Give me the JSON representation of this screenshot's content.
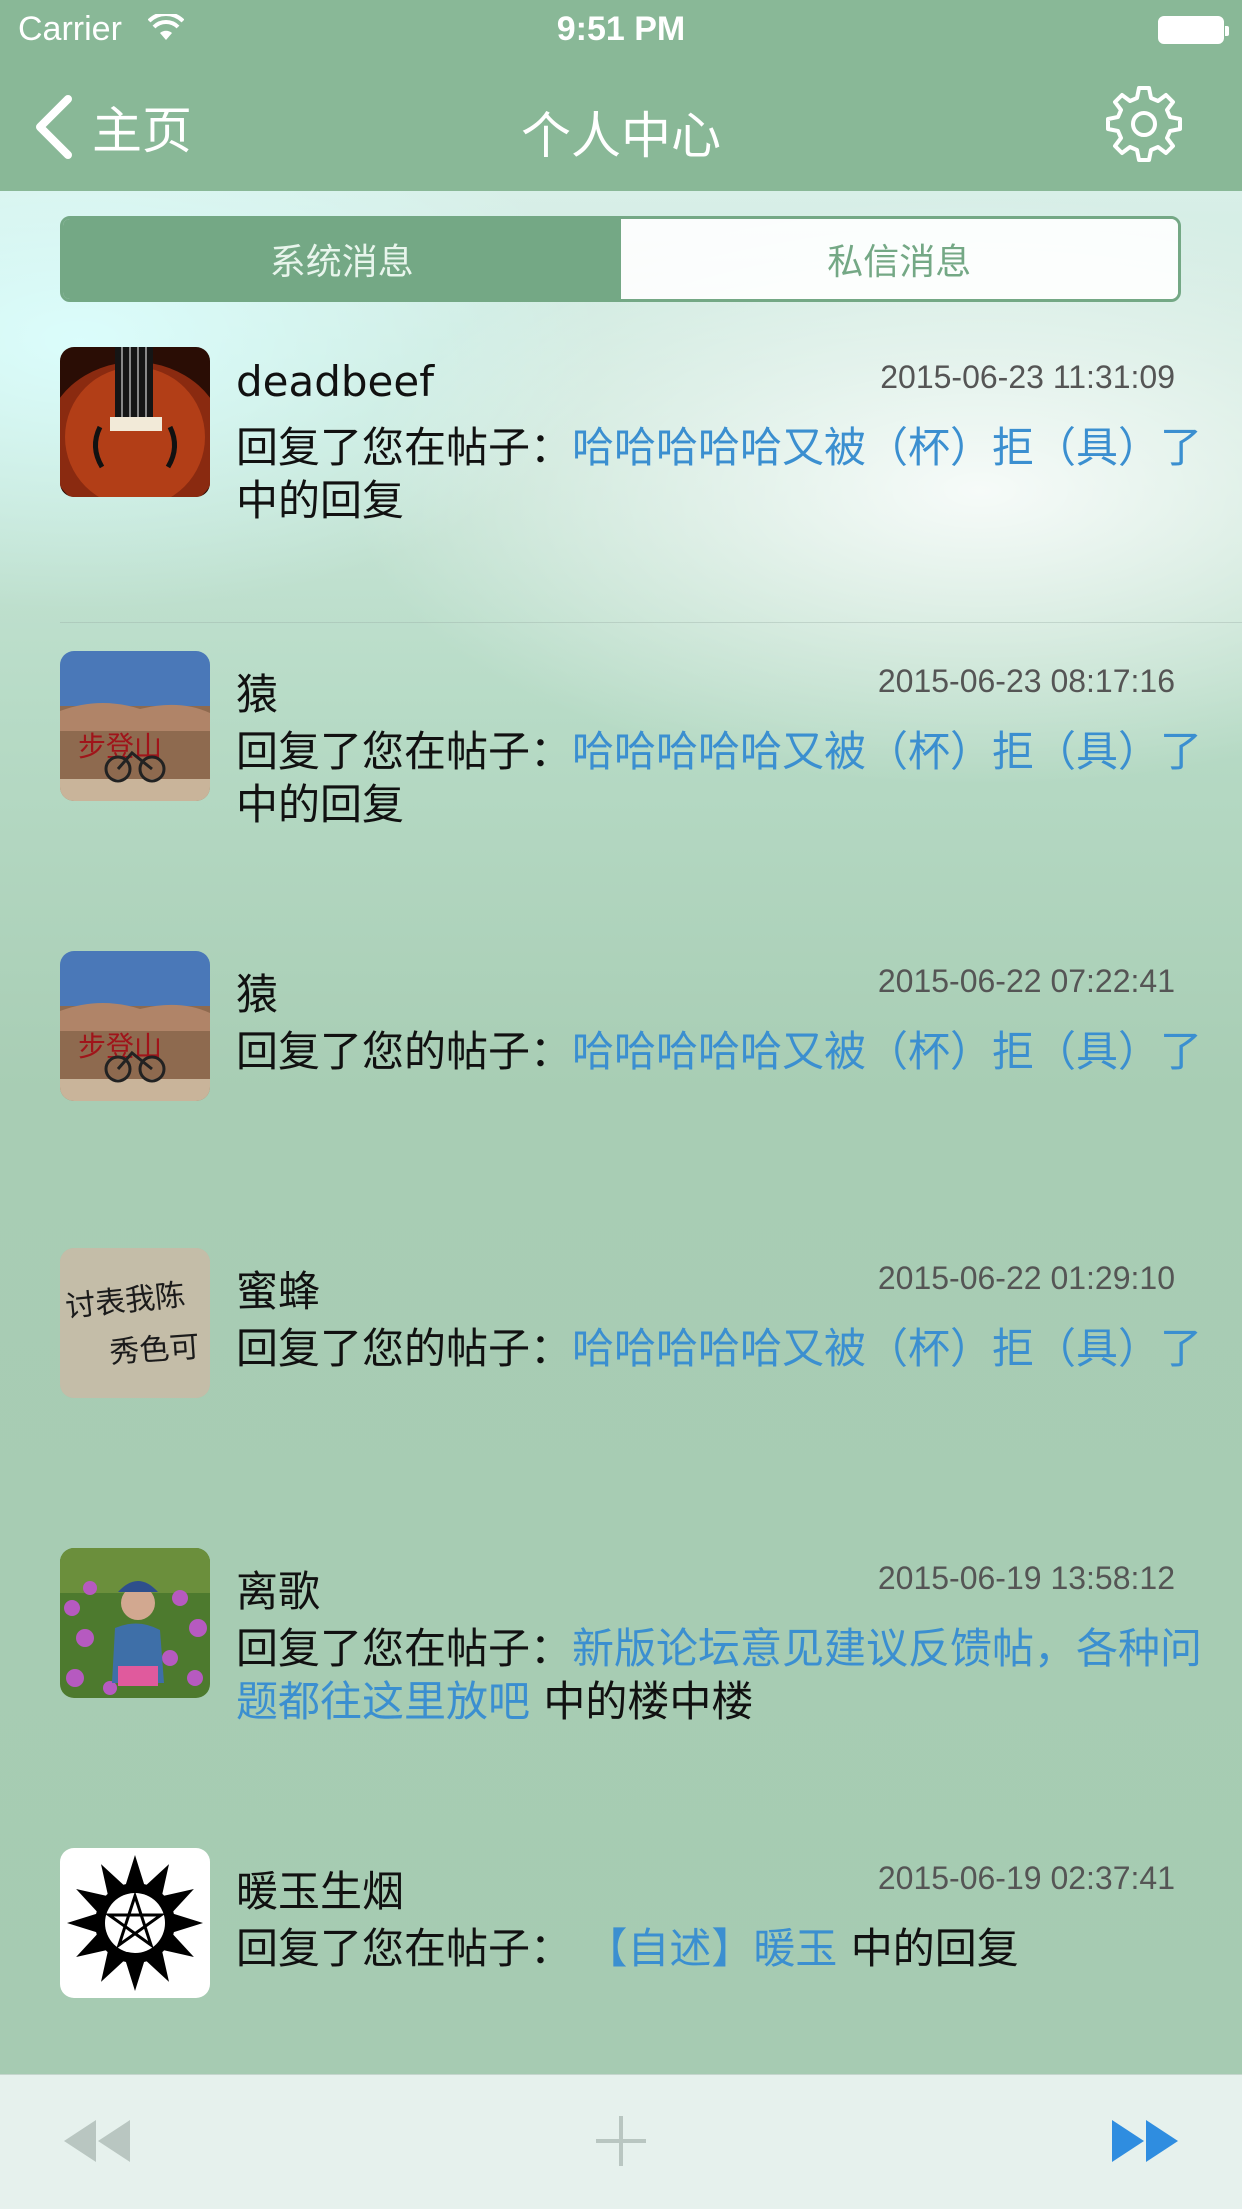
{
  "status_bar": {
    "carrier": "Carrier",
    "time": "9:51 PM"
  },
  "nav": {
    "back_label": "主页",
    "title": "个人中心"
  },
  "tabs": [
    {
      "label": "系统消息",
      "active": true
    },
    {
      "label": "私信消息",
      "active": false
    }
  ],
  "messages": [
    {
      "name": "deadbeef",
      "time": "2015-06-23 11:31:09",
      "prefix": "回复了您在帖子：",
      "link": "哈哈哈哈哈又被（杯）拒（具）了",
      "suffix": " 中的回复"
    },
    {
      "name": "猿",
      "time": "2015-06-23 08:17:16",
      "prefix": "回复了您在帖子：",
      "link": "哈哈哈哈哈又被（杯）拒（具）了",
      "suffix": " 中的回复"
    },
    {
      "name": "猿",
      "time": "2015-06-22 07:22:41",
      "prefix": "回复了您的帖子：",
      "link": "哈哈哈哈哈又被（杯）拒（具）了",
      "suffix": ""
    },
    {
      "name": "蜜蜂",
      "time": "2015-06-22 01:29:10",
      "prefix": "回复了您的帖子：",
      "link": "哈哈哈哈哈又被（杯）拒（具）了",
      "suffix": ""
    },
    {
      "name": "离歌",
      "time": "2015-06-19 13:58:12",
      "prefix": "回复了您在帖子：",
      "link": "新版论坛意见建议反馈帖，各种问题都往这里放吧",
      "suffix": " 中的楼中楼"
    },
    {
      "name": "暖玉生烟",
      "time": "2015-06-19 02:37:41",
      "prefix": "回复了您在帖子： ",
      "link": "【自述】暖玉",
      "suffix": " 中的回复"
    }
  ],
  "colors": {
    "nav_bar": "#89b897",
    "accent": "#74a885",
    "link": "#3b8fd0"
  },
  "toolbar_icons": [
    "rewind-icon",
    "plus-icon",
    "fast-forward-icon"
  ]
}
